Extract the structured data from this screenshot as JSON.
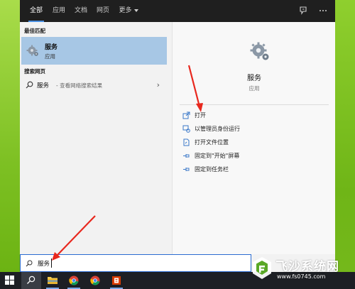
{
  "tabs": [
    {
      "label": "全部",
      "active": true
    },
    {
      "label": "应用",
      "active": false
    },
    {
      "label": "文档",
      "active": false
    },
    {
      "label": "网页",
      "active": false
    },
    {
      "label": "更多",
      "active": false
    }
  ],
  "left": {
    "best_match_heading": "最佳匹配",
    "best_match": {
      "title": "服务",
      "subtitle": "应用",
      "icon": "gear-icon"
    },
    "web_heading": "搜索网页",
    "web_result": {
      "query": "服务",
      "hint": "- 查看网络搜索结果"
    }
  },
  "right": {
    "app_title": "服务",
    "app_type": "应用",
    "actions": [
      {
        "label": "打开",
        "icon": "open-icon"
      },
      {
        "label": "以管理员身份运行",
        "icon": "shield-run-icon"
      },
      {
        "label": "打开文件位置",
        "icon": "file-location-icon"
      },
      {
        "label": "固定到\"开始\"屏幕",
        "icon": "pin-icon"
      },
      {
        "label": "固定到任务栏",
        "icon": "pin-taskbar-icon"
      }
    ]
  },
  "search": {
    "value": "服务"
  },
  "taskbar": {
    "items": [
      "windows-start-icon",
      "search-icon",
      "file-explorer-icon",
      "chrome-icon",
      "chrome-icon",
      "office-icon"
    ]
  },
  "watermark": {
    "title": "飞沙系统网",
    "url": "www.fs0745.com"
  },
  "colors": {
    "accent": "#4a90e2",
    "selection": "#a7c7e5",
    "arrow": "#e8281e",
    "taskbar": "#1d1f24"
  }
}
